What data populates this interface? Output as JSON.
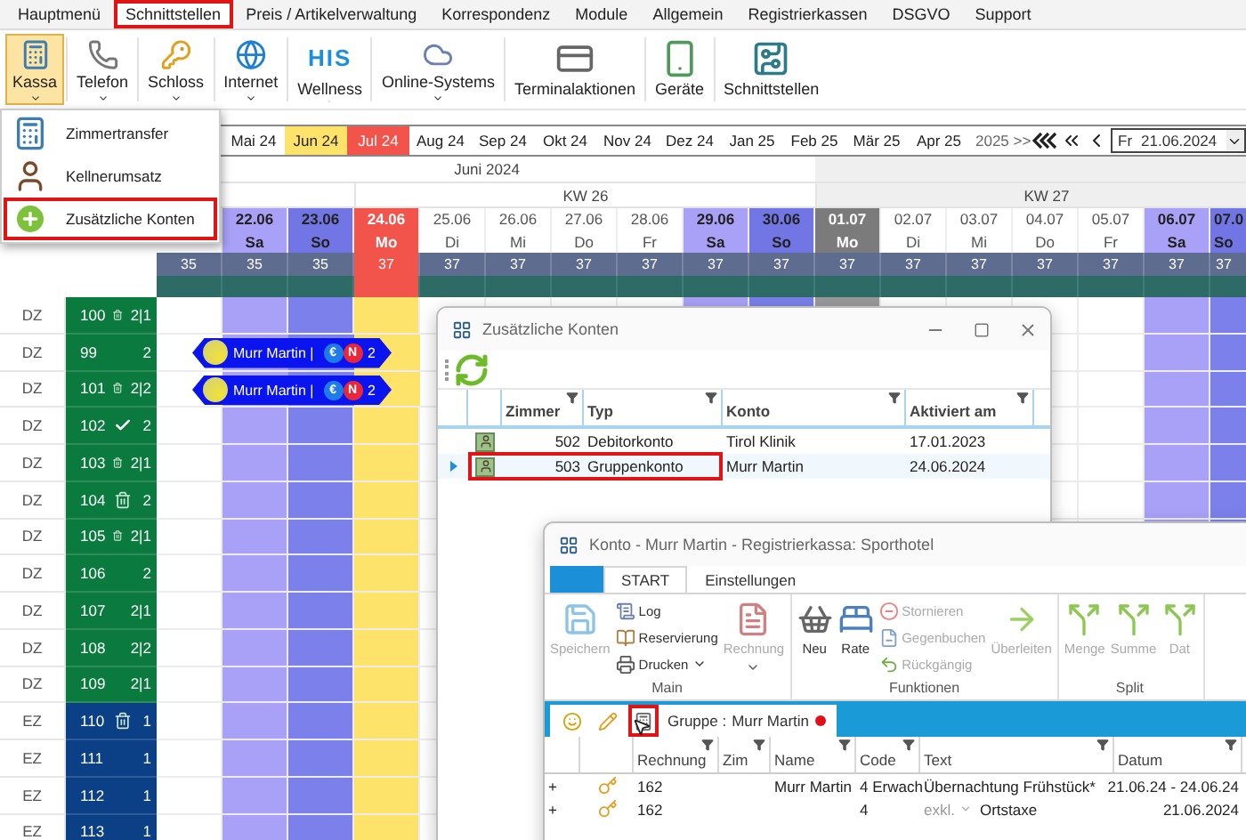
{
  "menu_tabs": [
    {
      "label": "Hauptmenü",
      "selected": false,
      "highlighted": false
    },
    {
      "label": "Schnittstellen",
      "selected": true,
      "highlighted": true
    },
    {
      "label": "Preis / Artikelverwaltung",
      "selected": false,
      "highlighted": false
    },
    {
      "label": "Korrespondenz",
      "selected": false,
      "highlighted": false
    },
    {
      "label": "Module",
      "selected": false,
      "highlighted": false
    },
    {
      "label": "Allgemein",
      "selected": false,
      "highlighted": false
    },
    {
      "label": "Registrierkassen",
      "selected": false,
      "highlighted": false
    },
    {
      "label": "DSGVO",
      "selected": false,
      "highlighted": false
    },
    {
      "label": "Support",
      "selected": false,
      "highlighted": false
    }
  ],
  "ribbon": [
    {
      "label": "Kassa",
      "selected": true,
      "caret": true
    },
    {
      "label": "Telefon",
      "selected": false,
      "caret": true
    },
    {
      "label": "Schloss",
      "selected": false,
      "caret": true
    },
    {
      "label": "Internet",
      "selected": false,
      "caret": true
    },
    {
      "label": "Wellness",
      "selected": false,
      "caret": true,
      "logo_text": "HIS"
    },
    {
      "label": "Online-Systems",
      "selected": false,
      "caret": true
    },
    {
      "label": "Terminalaktionen",
      "selected": false,
      "caret": false
    },
    {
      "label": "Geräte",
      "selected": false,
      "caret": false
    },
    {
      "label": "Schnittstellen",
      "selected": false,
      "caret": false
    }
  ],
  "kassa_menu": [
    {
      "label": "Zimmertransfer",
      "highlighted": false
    },
    {
      "label": "Kellnerumsatz",
      "highlighted": false
    },
    {
      "label": "Zusätzliche Konten",
      "highlighted": true
    }
  ],
  "months": [
    {
      "label": "Mai 24",
      "kind": "plain"
    },
    {
      "label": "Jun 24",
      "kind": "current"
    },
    {
      "label": "Jul 24",
      "kind": "today"
    },
    {
      "label": "Aug 24",
      "kind": "plain"
    },
    {
      "label": "Sep 24",
      "kind": "plain"
    },
    {
      "label": "Okt 24",
      "kind": "plain"
    },
    {
      "label": "Nov 24",
      "kind": "plain"
    },
    {
      "label": "Dez 24",
      "kind": "plain"
    },
    {
      "label": "Jan 25",
      "kind": "plain"
    },
    {
      "label": "Feb 25",
      "kind": "plain"
    },
    {
      "label": "Mär 25",
      "kind": "plain"
    },
    {
      "label": "Apr 25",
      "kind": "plain"
    },
    {
      "label": "2025 >>",
      "kind": "more"
    }
  ],
  "date_picker": {
    "weekday": "Fr",
    "value": "21.06.2024"
  },
  "calendar": {
    "months": [
      {
        "label": "Juni 2024",
        "weeks": [
          {
            "days": [
              {
                "kind": "weekday",
                "count": "35"
              },
              {
                "date": "22.06",
                "day": "Sa",
                "kind": "saturday",
                "count": "35"
              },
              {
                "date": "23.06",
                "day": "So",
                "kind": "sunday",
                "count": "35"
              }
            ]
          },
          {
            "label": "KW 26",
            "days": [
              {
                "date": "24.06",
                "day": "Mo",
                "kind": "today",
                "count": "37"
              },
              {
                "date": "25.06",
                "day": "Di",
                "kind": "weekday",
                "count": "37"
              },
              {
                "date": "26.06",
                "day": "Mi",
                "kind": "weekday",
                "count": "37"
              },
              {
                "date": "27.06",
                "day": "Do",
                "kind": "weekday",
                "count": "37"
              },
              {
                "date": "28.06",
                "day": "Fr",
                "kind": "weekday",
                "count": "37"
              },
              {
                "date": "29.06",
                "day": "Sa",
                "kind": "saturday",
                "count": "37"
              },
              {
                "date": "30.06",
                "day": "So",
                "kind": "sunday",
                "count": "37"
              }
            ]
          }
        ]
      },
      {
        "weeks": [
          {
            "label": "KW 27",
            "days": [
              {
                "date": "01.07",
                "day": "Mo",
                "kind": "closed",
                "count": "37"
              },
              {
                "date": "02.07",
                "day": "Di",
                "kind": "weekday",
                "count": "37"
              },
              {
                "date": "03.07",
                "day": "Mi",
                "kind": "weekday",
                "count": "37"
              },
              {
                "date": "04.07",
                "day": "Do",
                "kind": "weekday",
                "count": "37"
              },
              {
                "date": "05.07",
                "day": "Fr",
                "kind": "weekday",
                "count": "37"
              },
              {
                "date": "06.07",
                "day": "Sa",
                "kind": "saturday",
                "count": "37"
              },
              {
                "date": "07.0",
                "day": "So",
                "kind": "sunday",
                "count": "37"
              }
            ]
          }
        ]
      }
    ]
  },
  "rooms": [
    {
      "type": "DZ",
      "number": "100",
      "kind": "dirty",
      "beds": "2|1",
      "color": "#0b7a3e"
    },
    {
      "type": "DZ",
      "number": "99",
      "kind": "plain",
      "beds": "2",
      "color": "#0b7a3e",
      "booking": {
        "guest": "Murr Martin |",
        "badges": [
          "€",
          "N"
        ],
        "count": "2"
      }
    },
    {
      "type": "DZ",
      "number": "101",
      "kind": "dirty",
      "beds": "2|2",
      "color": "#0b7a3e",
      "booking": {
        "guest": "Murr Martin |",
        "badges": [
          "€",
          "N"
        ],
        "count": "2"
      }
    },
    {
      "type": "DZ",
      "number": "102",
      "kind": "clean",
      "beds": "2",
      "color": "#0b7a3e"
    },
    {
      "type": "DZ",
      "number": "103",
      "kind": "dirty",
      "beds": "2|1",
      "color": "#0b7a3e"
    },
    {
      "type": "DZ",
      "number": "104",
      "kind": "dirty",
      "beds": "2",
      "color": "#0b7a3e"
    },
    {
      "type": "DZ",
      "number": "105",
      "kind": "dirty",
      "beds": "2|1",
      "color": "#0b7a3e"
    },
    {
      "type": "DZ",
      "number": "106",
      "kind": "plain",
      "beds": "2",
      "color": "#0b7a3e"
    },
    {
      "type": "DZ",
      "number": "107",
      "kind": "plain",
      "beds": "2|1",
      "color": "#0b7a3e"
    },
    {
      "type": "DZ",
      "number": "108",
      "kind": "plain",
      "beds": "2|2",
      "color": "#0b7a3e"
    },
    {
      "type": "DZ",
      "number": "109",
      "kind": "plain",
      "beds": "2|1",
      "color": "#0b7a3e"
    },
    {
      "type": "EZ",
      "number": "110",
      "kind": "dirty",
      "beds": "1",
      "color": "#0b3f86"
    },
    {
      "type": "EZ",
      "number": "111",
      "kind": "plain",
      "beds": "1",
      "color": "#0b3f86"
    },
    {
      "type": "EZ",
      "number": "112",
      "kind": "plain",
      "beds": "1",
      "color": "#0b3f86"
    },
    {
      "type": "EZ",
      "number": "113",
      "kind": "plain",
      "beds": "1",
      "color": "#0b3f86"
    }
  ],
  "accounts_dialog": {
    "title": "Zusätzliche Konten",
    "columns": [
      "Zimmer",
      "Typ",
      "Konto",
      "Aktiviert am"
    ],
    "rows": [
      {
        "cells": [
          "502",
          "Debitorkonto",
          "Tirol Klinik",
          "17.01.2023"
        ],
        "current": false,
        "highlighted": false
      },
      {
        "cells": [
          "503",
          "Gruppenkonto",
          "Murr Martin",
          "24.06.2024"
        ],
        "current": true,
        "highlighted": true
      }
    ]
  },
  "account_dialog": {
    "title": "Konto - Murr Martin - Registrierkassa: Sporthotel",
    "tabs": [
      {
        "label": "START",
        "selected": true
      },
      {
        "label": "Einstellungen",
        "selected": false
      }
    ],
    "groups": [
      {
        "label": "Main",
        "items": [
          {
            "label": "Speichern",
            "kind": "large",
            "disabled": true,
            "caret": false
          },
          {
            "label": "Log",
            "kind": "small",
            "disabled": false,
            "caret": false
          },
          {
            "label": "Reservierung",
            "kind": "small",
            "disabled": false,
            "caret": false
          },
          {
            "label": "Drucken",
            "kind": "small",
            "disabled": false,
            "caret": true
          },
          {
            "label": "Rechnung",
            "kind": "large",
            "disabled": true,
            "caret": true
          }
        ]
      },
      {
        "label": "Funktionen",
        "items": [
          {
            "label": "Neu",
            "kind": "large",
            "disabled": false,
            "caret": false
          },
          {
            "label": "Rate",
            "kind": "large",
            "disabled": false,
            "caret": false
          },
          {
            "label": "Stornieren",
            "kind": "small",
            "disabled": true,
            "caret": false
          },
          {
            "label": "Gegenbuchen",
            "kind": "small",
            "disabled": true,
            "caret": false
          },
          {
            "label": "Rückgängig",
            "kind": "small",
            "disabled": true,
            "caret": false
          },
          {
            "label": "Überleiten",
            "kind": "large",
            "disabled": true,
            "caret": false
          }
        ]
      },
      {
        "label": "Split",
        "items": [
          {
            "label": "Menge",
            "kind": "large",
            "disabled": true,
            "caret": false
          },
          {
            "label": "Summe",
            "kind": "large",
            "disabled": true,
            "caret": false
          },
          {
            "label": "Dat",
            "kind": "large",
            "disabled": true,
            "caret": false
          }
        ]
      }
    ],
    "group_tab": {
      "label": "Gruppe :",
      "name": "Murr Martin",
      "tools": [
        {
          "highlighted": false
        },
        {
          "highlighted": false
        },
        {
          "highlighted": true
        }
      ]
    },
    "columns": [
      "Rechnung",
      "Zim",
      "Name",
      "Code",
      "Text",
      "Datum"
    ],
    "rows": [
      {
        "expander": "+",
        "cells": [
          "162",
          "",
          "Murr Martin",
          "4 Erwach",
          "Übernachtung Frühstück*",
          "21.06.24 - 24.06.24"
        ]
      },
      {
        "expander": "+",
        "cells": [
          "162",
          "",
          "",
          "4",
          "Ortstaxe",
          "21.06.2024"
        ],
        "text_prefix": "exkl."
      }
    ]
  }
}
